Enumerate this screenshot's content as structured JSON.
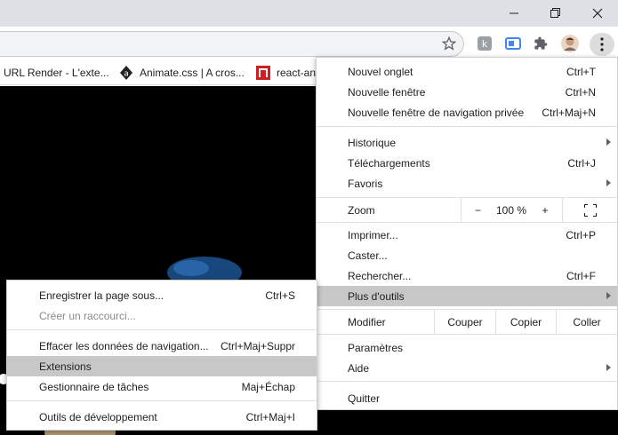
{
  "colors": {
    "titlebar": "#dee1e6",
    "highlight": "#c8c8c8",
    "content_bg": "#000000"
  },
  "toolbar": {
    "icons": [
      "star-icon",
      "extension-k-icon",
      "extension-tab-icon",
      "puzzle-icon",
      "profile-avatar",
      "kebab-menu-icon"
    ]
  },
  "bookmarks": [
    {
      "label": "URL Render - L'exte...",
      "icon": "none"
    },
    {
      "label": "Animate.css | A cros...",
      "icon": "a-logo-icon"
    },
    {
      "label": "react-an",
      "icon": "red-n-icon"
    }
  ],
  "main_menu": {
    "new_tab": {
      "label": "Nouvel onglet",
      "shortcut": "Ctrl+T"
    },
    "new_window": {
      "label": "Nouvelle fenêtre",
      "shortcut": "Ctrl+N"
    },
    "new_incognito": {
      "label": "Nouvelle fenêtre de navigation privée",
      "shortcut": "Ctrl+Maj+N"
    },
    "history": {
      "label": "Historique"
    },
    "downloads": {
      "label": "Téléchargements",
      "shortcut": "Ctrl+J"
    },
    "bookmarks": {
      "label": "Favoris"
    },
    "zoom": {
      "label": "Zoom",
      "minus": "−",
      "value": "100 %",
      "plus": "+"
    },
    "print": {
      "label": "Imprimer...",
      "shortcut": "Ctrl+P"
    },
    "cast": {
      "label": "Caster..."
    },
    "find": {
      "label": "Rechercher...",
      "shortcut": "Ctrl+F"
    },
    "more_tools": {
      "label": "Plus d'outils"
    },
    "edit": {
      "label": "Modifier",
      "cut": "Couper",
      "copy": "Copier",
      "paste": "Coller"
    },
    "settings": {
      "label": "Paramètres"
    },
    "help": {
      "label": "Aide"
    },
    "quit": {
      "label": "Quitter"
    }
  },
  "submenu": {
    "save_page": {
      "label": "Enregistrer la page sous...",
      "shortcut": "Ctrl+S"
    },
    "create_shortcut": {
      "label": "Créer un raccourci..."
    },
    "clear_data": {
      "label": "Effacer les données de navigation...",
      "shortcut": "Ctrl+Maj+Suppr"
    },
    "extensions": {
      "label": "Extensions"
    },
    "task_manager": {
      "label": "Gestionnaire de tâches",
      "shortcut": "Maj+Échap"
    },
    "dev_tools": {
      "label": "Outils de développement",
      "shortcut": "Ctrl+Maj+I"
    }
  }
}
